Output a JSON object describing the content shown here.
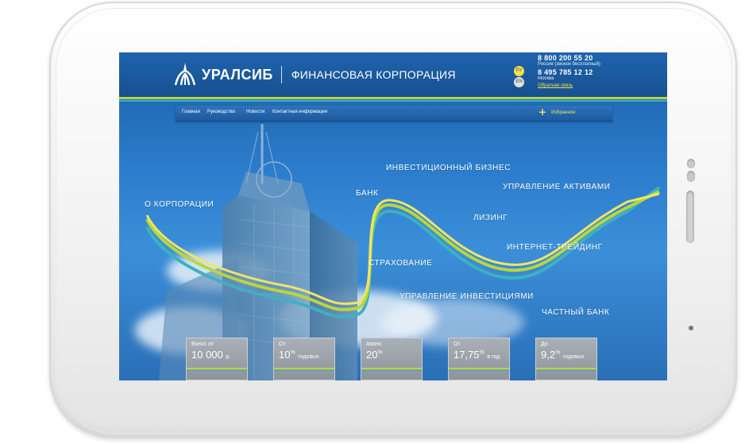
{
  "header": {
    "brand": "УРАЛСИБ",
    "subtitle": "ФИНАНСОВАЯ КОРПОРАЦИЯ",
    "lang_ru": "РУ",
    "lang_en": "EN",
    "phone1": "8 800 200 55 20",
    "phone1_note": "Россия (звонок бесплатный)",
    "phone2": "8 495 785 12 12",
    "phone2_note": "Москва",
    "feedback": "Обратная связь"
  },
  "nav": {
    "items": [
      "Главная",
      "Руководство",
      "Новости",
      "Контактная информация"
    ],
    "favorites": "Избранное"
  },
  "curve_labels": {
    "about": "О КОРПОРАЦИИ",
    "bank": "БАНК",
    "investment": "ИНВЕСТИЦИОННЫЙ БИЗНЕС",
    "assets": "УПРАВЛЕНИЕ АКТИВАМИ",
    "leasing": "ЛИЗИНГ",
    "trading": "ИНТЕРНЕТ-ТРЕЙДИНГ",
    "insurance": "СТРАХОВАНИЕ",
    "invest_mgmt": "УПРАВЛЕНИЕ ИНВЕСТИЦИЯМИ",
    "private_bank": "ЧАСТНЫЙ БАНК"
  },
  "cards": [
    {
      "top": "Взнос от",
      "big": "10 000",
      "sup": "",
      "small": "р."
    },
    {
      "top": "От",
      "big": "10",
      "sup": "%",
      "small": "годовых"
    },
    {
      "top": "Аванс",
      "big": "20",
      "sup": "%",
      "small": ""
    },
    {
      "top": "От",
      "big": "17,75",
      "sup": "%",
      "small": "в год"
    },
    {
      "top": "До",
      "big": "9,2",
      "sup": "%",
      "small": "годовых"
    }
  ],
  "colors": {
    "accent_yellow": "#b9d63c",
    "accent_teal": "#3fb0c0",
    "header_blue": "#1f64ad"
  },
  "icons": [
    "uralsib-logo-icon",
    "plus-icon"
  ]
}
